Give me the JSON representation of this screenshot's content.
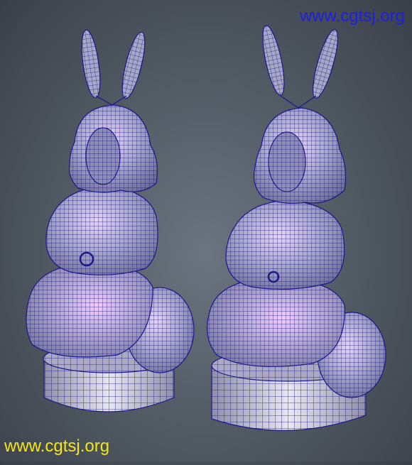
{
  "watermark_top": {
    "text": "www.cgtsj.org",
    "color": "#1f1fe0"
  },
  "watermark_bottom": {
    "text": "www.cgtsj.org",
    "color": "#f3e516"
  },
  "scene": {
    "background": "#55606b",
    "mesh_color": "#1a1a8a",
    "surface_color": "#b9b6cf",
    "highlight_color": "#f0c6f6"
  }
}
